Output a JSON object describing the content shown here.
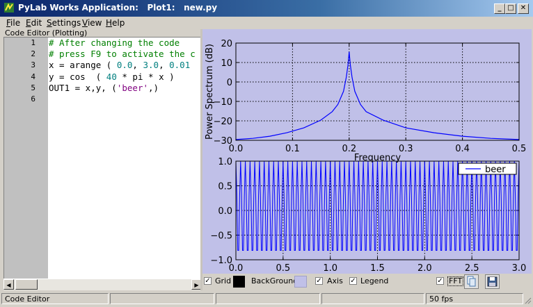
{
  "window": {
    "title": "PyLab Works Application:   Plot1:   new.py",
    "controls": [
      "_",
      "□",
      "✕"
    ]
  },
  "menu": [
    {
      "label": "File",
      "key": "F"
    },
    {
      "label": "Edit",
      "key": "E"
    },
    {
      "label": "Settings",
      "key": "S"
    },
    {
      "label": "View",
      "key": "V"
    },
    {
      "label": "Help",
      "key": "H"
    }
  ],
  "editor": {
    "label": "Code Editor (Plotting)",
    "line_numbers": [
      "1",
      "2",
      "3",
      "4",
      "5",
      "6"
    ],
    "lines": [
      [
        {
          "t": "# After changing the code",
          "c": "cm"
        }
      ],
      [
        {
          "t": "# press F9 to activate the c",
          "c": "cm"
        }
      ],
      [
        {
          "t": "x = arange ( ",
          "c": ""
        },
        {
          "t": "0.0",
          "c": "num"
        },
        {
          "t": ", ",
          "c": ""
        },
        {
          "t": "3.0",
          "c": "num"
        },
        {
          "t": ", ",
          "c": ""
        },
        {
          "t": "0.01",
          "c": "num"
        }
      ],
      [
        {
          "t": "y = cos  ( ",
          "c": ""
        },
        {
          "t": "40",
          "c": "num"
        },
        {
          "t": " * pi * x )",
          "c": ""
        }
      ],
      [
        {
          "t": "OUT1 = x,y, (",
          "c": ""
        },
        {
          "t": "'beer'",
          "c": "str"
        },
        {
          "t": ",)",
          "c": ""
        }
      ],
      []
    ]
  },
  "plot_toolbar": {
    "grid_label": "Grid",
    "grid_checked": true,
    "grid_color": "#000000",
    "background_label": "BackGround-",
    "background_color": "#c0c0e8",
    "axis_label": "Axis",
    "axis_checked": true,
    "legend_label": "Legend",
    "legend_checked": true,
    "fft_label": "FFT",
    "fft_checked": true
  },
  "statusbar": {
    "left": "Code Editor",
    "fps": "50 fps"
  },
  "chart_data": [
    {
      "type": "line",
      "ylabel": "Power Spectrum (dB)",
      "xlabel": "Frequency",
      "xlim": [
        0.0,
        0.5
      ],
      "ylim": [
        -30,
        20
      ],
      "xticks": [
        "0.0",
        "0.1",
        "0.2",
        "0.3",
        "0.4",
        "0.5"
      ],
      "yticks": [
        "20",
        "10",
        "0",
        "−10",
        "−20",
        "−30"
      ],
      "grid": true,
      "series": [
        {
          "color": "#0000ff",
          "x": [
            0.0,
            0.03,
            0.06,
            0.09,
            0.12,
            0.15,
            0.17,
            0.18,
            0.19,
            0.195,
            0.198,
            0.2,
            0.202,
            0.205,
            0.21,
            0.22,
            0.23,
            0.26,
            0.3,
            0.35,
            0.4,
            0.45,
            0.5
          ],
          "y": [
            -29.6,
            -29.0,
            -27.9,
            -26.1,
            -23.6,
            -19.6,
            -15.3,
            -11.6,
            -4.8,
            2.5,
            9.0,
            15.5,
            9.0,
            2.5,
            -4.8,
            -11.6,
            -15.3,
            -19.6,
            -23.6,
            -26.1,
            -27.9,
            -29.0,
            -29.6
          ]
        }
      ]
    },
    {
      "type": "line",
      "xlim": [
        0.0,
        3.0
      ],
      "ylim": [
        -1.0,
        1.0
      ],
      "xticks": [
        "0.0",
        "0.5",
        "1.0",
        "1.5",
        "2.0",
        "2.5",
        "3.0"
      ],
      "yticks": [
        "1.0",
        "0.5",
        "0.0",
        "−0.5",
        "−1.0"
      ],
      "grid": true,
      "legend": {
        "position": "top-right",
        "entries": [
          "beer"
        ]
      },
      "series": [
        {
          "name": "beer",
          "color": "#0000ff",
          "function": "cos(40*pi*x)",
          "x_start": 0.0,
          "x_stop": 3.0,
          "x_step": 0.01
        }
      ]
    }
  ]
}
